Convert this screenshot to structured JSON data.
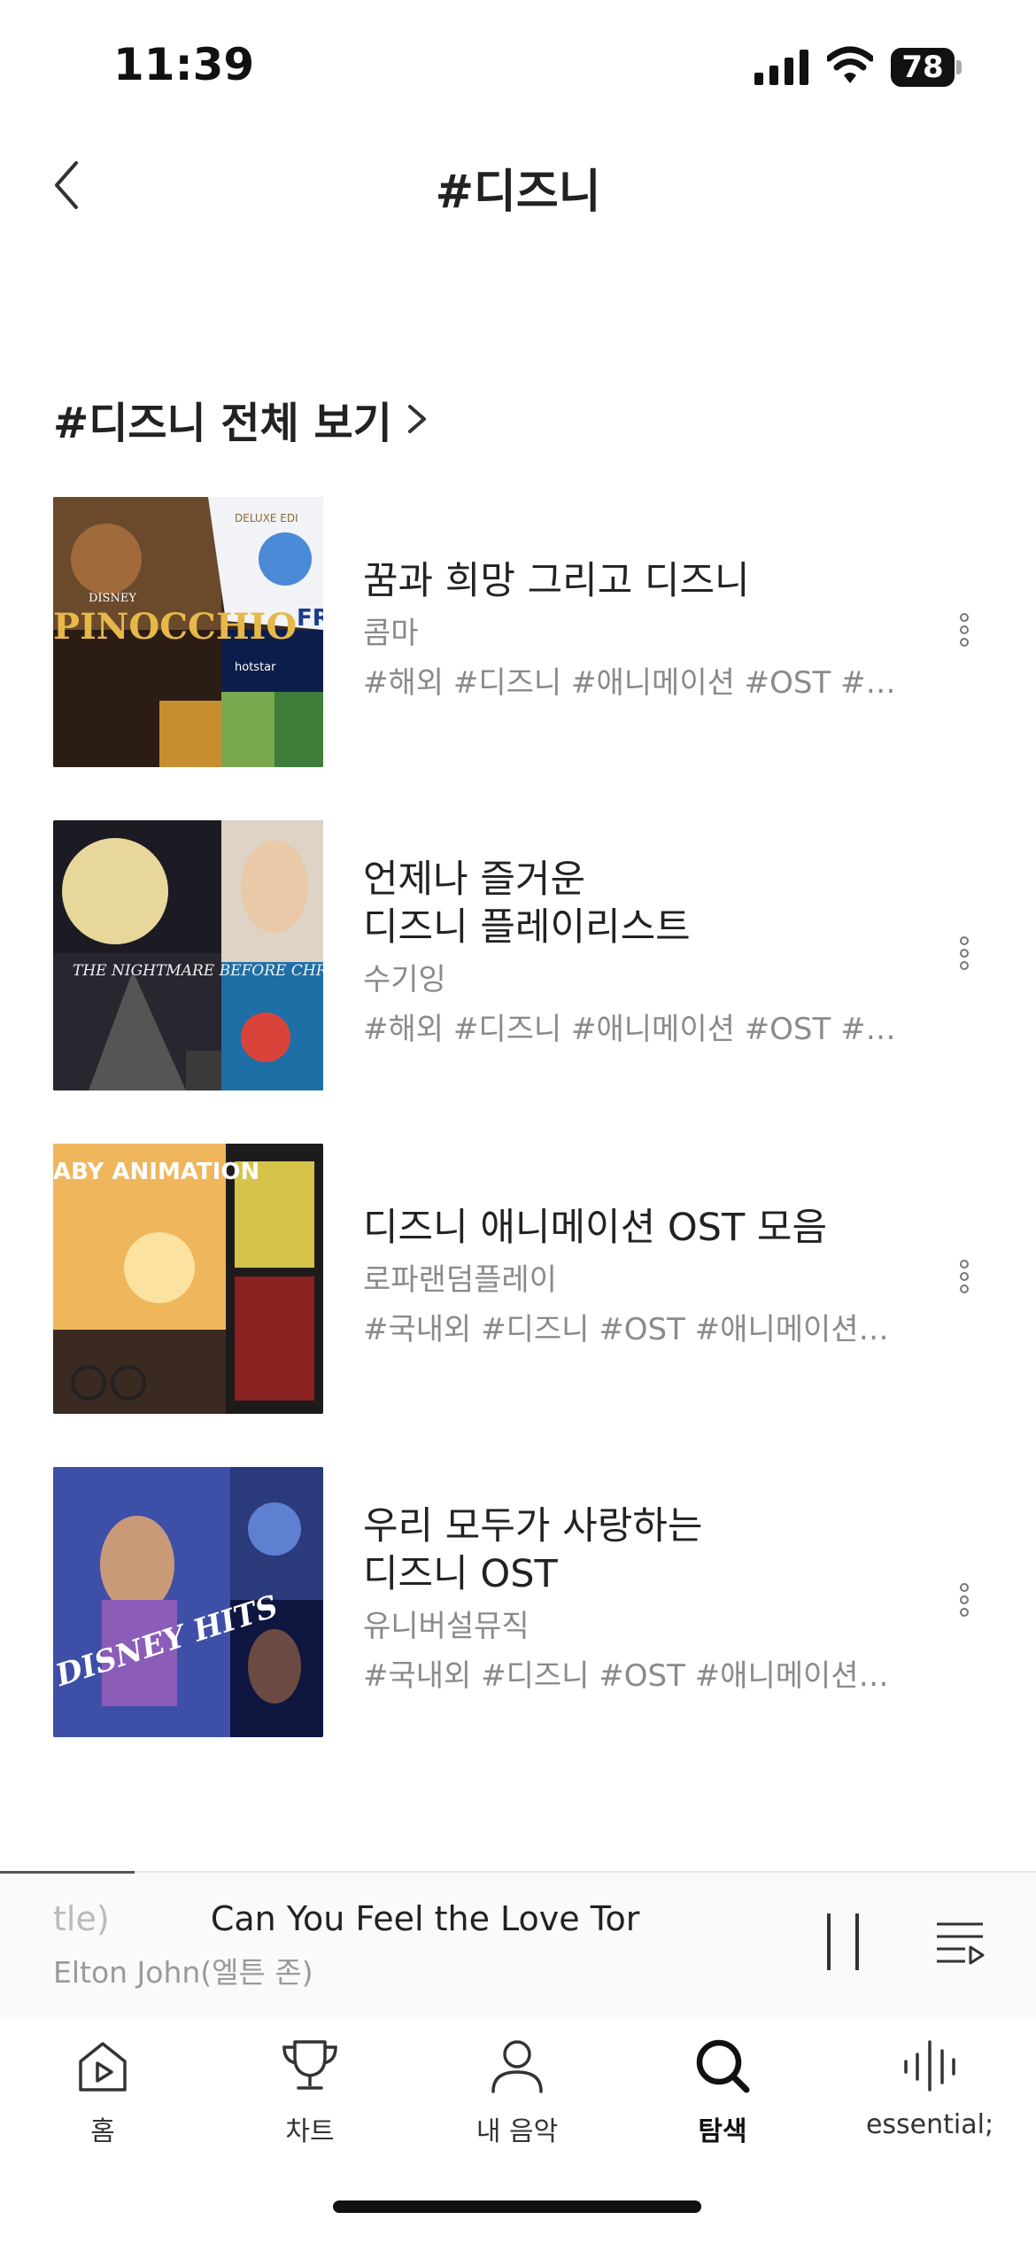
{
  "status_bar": {
    "time": "11:39",
    "battery": "78"
  },
  "header": {
    "title": "#디즈니"
  },
  "section": {
    "title": "#디즈니 전체 보기"
  },
  "playlists": [
    {
      "title": "꿈과 희망 그리고 디즈니",
      "author": "콤마",
      "tags": "#해외  #디즈니  #애니메이션  #OST  #…"
    },
    {
      "title": "언제나 즐거운\n디즈니 플레이리스트",
      "author": "수기잉",
      "tags": "#해외  #디즈니  #애니메이션  #OST  #…"
    },
    {
      "title": "디즈니 애니메이션 OST 모음",
      "author": "로파랜덤플레이",
      "tags": "#국내외  #디즈니  #OST  #애니메이션…"
    },
    {
      "title": "우리 모두가 사랑하는\n디즈니 OST",
      "author": "유니버설뮤직",
      "tags": "#국내외  #디즈니  #OST  #애니메이션…"
    }
  ],
  "covers": [
    {
      "texts": [
        "PINOCCHIO",
        "DISNEY",
        "DELUXE EDI",
        "hotstar",
        "FR"
      ]
    },
    {
      "texts": [
        "THE NIGHTMARE BEFORE CHRISTMAS"
      ]
    },
    {
      "texts": [
        "ABY ANIMATION"
      ]
    },
    {
      "texts": [
        "DISNEY HITS"
      ]
    }
  ],
  "player": {
    "title_prefix": "tle)",
    "title": "Can You Feel the Love Tor",
    "artist": "Elton John(엘튼 존)",
    "progress": 0.13
  },
  "tabs": [
    {
      "label": "홈",
      "icon": "home-play-icon"
    },
    {
      "label": "차트",
      "icon": "trophy-icon"
    },
    {
      "label": "내 음악",
      "icon": "person-icon"
    },
    {
      "label": "탐색",
      "icon": "search-icon",
      "active": true
    },
    {
      "label": "essential;",
      "icon": "waveform-icon"
    }
  ]
}
